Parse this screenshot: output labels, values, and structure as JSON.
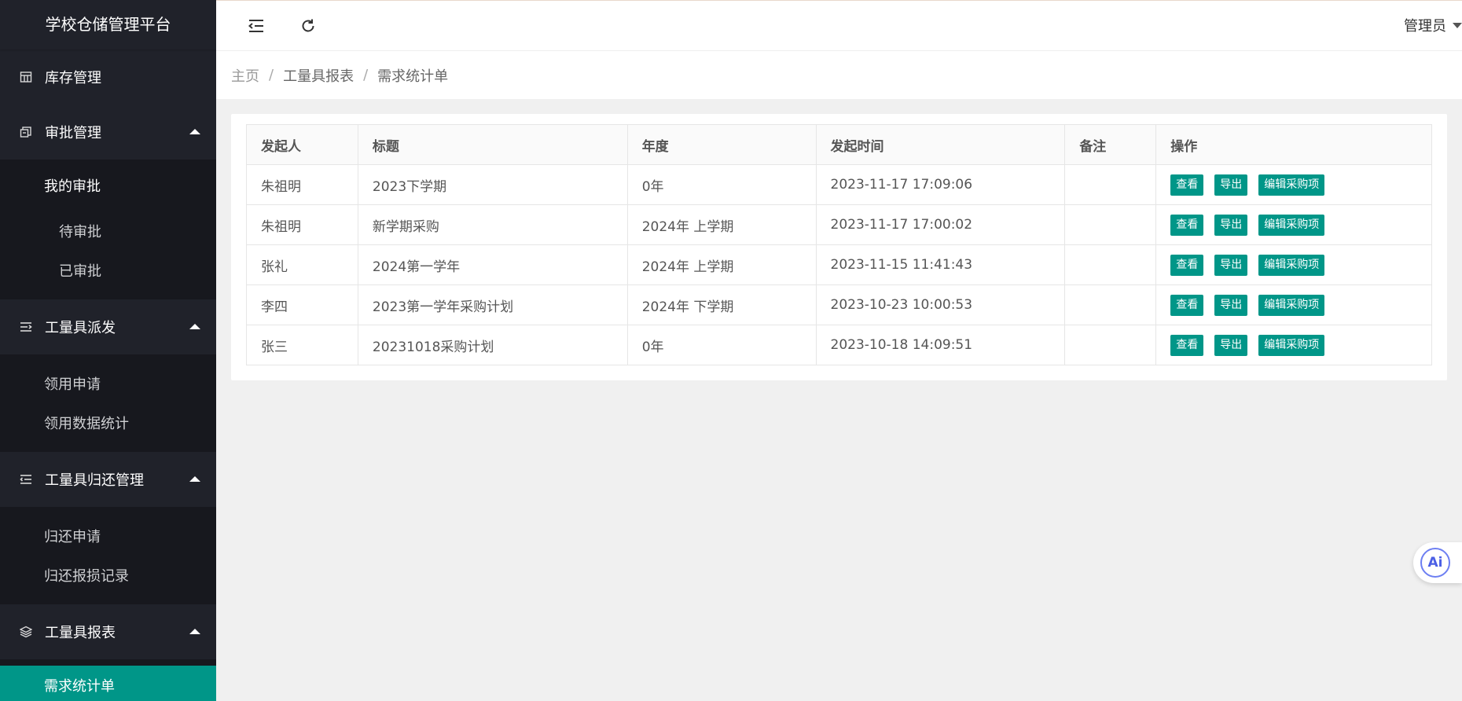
{
  "sidebar": {
    "logo": "学校仓储管理平台",
    "inventory": "库存管理",
    "approval": {
      "label": "审批管理",
      "my_approval": "我的审批",
      "pending": "待审批",
      "approved": "已审批"
    },
    "dispatch": {
      "label": "工量具派发",
      "apply": "领用申请",
      "stats": "领用数据统计"
    },
    "return_mgmt": {
      "label": "工量具归还管理",
      "return_apply": "归还申请",
      "damage_record": "归还报损记录"
    },
    "report": {
      "label": "工量具报表",
      "demand": "需求统计单"
    }
  },
  "header": {
    "user": "管理员"
  },
  "breadcrumb": {
    "home": "主页",
    "section": "工量具报表",
    "current": "需求统计单",
    "separator": "/"
  },
  "table": {
    "headers": [
      "发起人",
      "标题",
      "年度",
      "发起时间",
      "备注",
      "操作"
    ],
    "actions": {
      "view": "查看",
      "export": "导出",
      "edit": "编辑采购项"
    },
    "rows": [
      {
        "initiator": "朱祖明",
        "title": "2023下学期",
        "year": "0年",
        "time": "2023-11-17 17:09:06",
        "note": ""
      },
      {
        "initiator": "朱祖明",
        "title": "新学期采购",
        "year": "2024年 上学期",
        "time": "2023-11-17 17:00:02",
        "note": ""
      },
      {
        "initiator": "张礼",
        "title": "2024第一学年",
        "year": "2024年 上学期",
        "time": "2023-11-15 11:41:43",
        "note": ""
      },
      {
        "initiator": "李四",
        "title": "2023第一学年采购计划",
        "year": "2024年 下学期",
        "time": "2023-10-23 10:00:53",
        "note": ""
      },
      {
        "initiator": "张三",
        "title": "20231018采购计划",
        "year": "0年",
        "time": "2023-10-18 14:09:51",
        "note": ""
      }
    ]
  },
  "ai_button": "Ai",
  "colors": {
    "accent": "#009688",
    "sidebar": "#20222a",
    "sidebar_child": "#17181e"
  }
}
